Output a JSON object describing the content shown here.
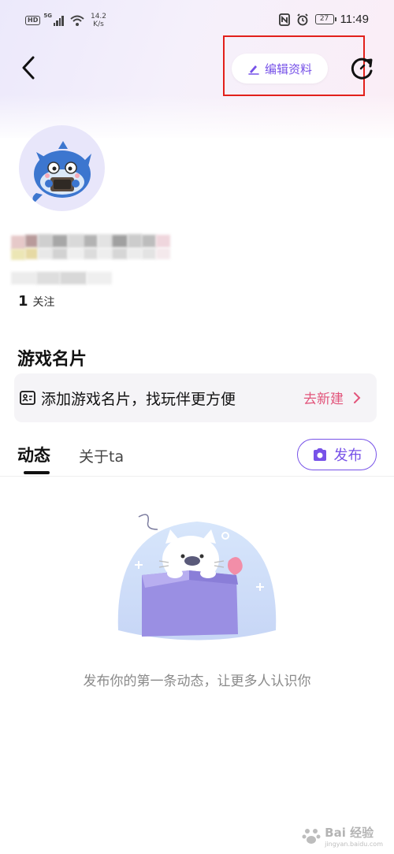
{
  "status_bar": {
    "hd": "HD",
    "network": "5G",
    "speed_value": "14.2",
    "speed_unit": "K/s",
    "battery": "27",
    "time": "11:49"
  },
  "header": {
    "edit_profile_label": "编辑资料"
  },
  "profile": {
    "follow_count": "1",
    "follow_label": "关注"
  },
  "game_card": {
    "title": "游戏名片",
    "text": "添加游戏名片，找玩伴更方便",
    "create_label": "去新建"
  },
  "tabs": {
    "active": "动态",
    "inactive": "关于ta",
    "publish_label": "发布"
  },
  "empty_state": {
    "text": "发布你的第一条动态，让更多人认识你"
  },
  "watermark": {
    "text": "Bai 经验",
    "url": "jingyan.baidu.com"
  },
  "colors": {
    "accent": "#7752e8",
    "link": "#e2557b",
    "highlight": "#e2201b"
  }
}
